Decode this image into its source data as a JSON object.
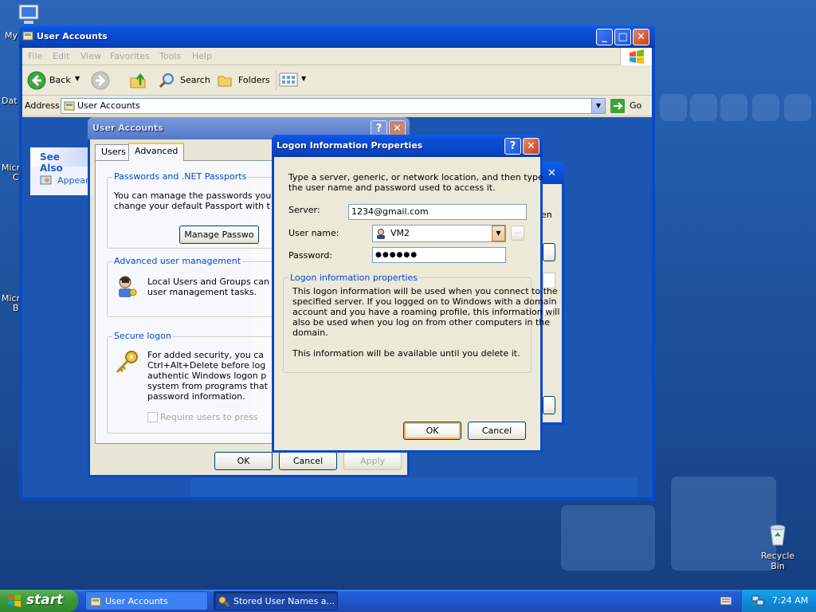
{
  "desktop": {
    "icons": [
      {
        "label": "My"
      },
      {
        "label": "Dat"
      },
      {
        "label": "Micro"
      },
      {
        "label": "C"
      },
      {
        "label": "Micro"
      },
      {
        "label": "B"
      },
      {
        "label": "Recycle Bin"
      }
    ]
  },
  "taskbar": {
    "start_label": "start",
    "tasks": [
      {
        "label": "User Accounts"
      },
      {
        "label": "Stored User Names a..."
      }
    ],
    "clock": "7:24 AM"
  },
  "explorer": {
    "title": "User Accounts",
    "menu": [
      "File",
      "Edit",
      "View",
      "Favorites",
      "Tools",
      "Help"
    ],
    "toolbar": {
      "back": "Back",
      "search": "Search",
      "folders": "Folders"
    },
    "address_label": "Address",
    "address_value": "User Accounts",
    "go_label": "Go",
    "see_also": {
      "title": "See Also",
      "item": "Appear"
    }
  },
  "ua_dialog": {
    "title": "User Accounts",
    "tabs": [
      "Users",
      "Advanced"
    ],
    "passports": {
      "title": "Passwords and .NET Passports",
      "text_1": "You can manage the passwords you",
      "text_2": "change your default Passport with t",
      "button": "Manage Passwo"
    },
    "advanced_mgmt": {
      "title": "Advanced user management",
      "text_1": "Local Users and Groups can",
      "text_2": "user management tasks."
    },
    "secure_logon": {
      "title": "Secure logon",
      "text_1": "For added security, you ca",
      "text_2": "Ctrl+Alt+Delete before log",
      "text_3": "authentic Windows logon p",
      "text_4": "system from programs that",
      "text_5": "password information.",
      "checkbox": "Require users to press"
    },
    "buttons": {
      "ok": "OK",
      "cancel": "Cancel",
      "apply": "Apply"
    }
  },
  "stored_dialog": {
    "title_frag": "S",
    "side_text": [
      "W",
      "sit",
      "cl"
    ],
    "right_text": "en"
  },
  "logon_dialog": {
    "title": "Logon Information Properties",
    "intro_1": "Type a server, generic, or network location, and then type",
    "intro_2": "the user name and password used to access it.",
    "server_label": "Server:",
    "server_value": "1234@gmail.com",
    "username_label": "User name:",
    "username_value": "VM2",
    "browse_label": "...",
    "password_label": "Password:",
    "password_value": "●●●●●●",
    "props_title": "Logon information properties",
    "props_1": "This logon information will be used when you connect to the",
    "props_2": "specified server. If you logged on to Windows with a domain",
    "props_3": "account and you have a roaming profile, this information will",
    "props_4": "also be used when you log on from other computers in the",
    "props_5": "domain.",
    "props_6": "This information will be available until you delete it.",
    "ok": "OK",
    "cancel": "Cancel"
  }
}
